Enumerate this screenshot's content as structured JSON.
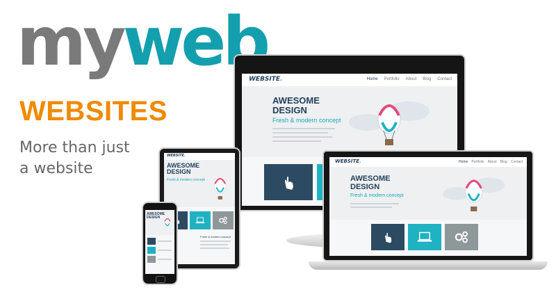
{
  "brand": {
    "logo_part1": "my",
    "logo_part2": "web",
    "headline": "WEBSITES",
    "tagline_line1": "More than just",
    "tagline_line2": "a website"
  },
  "mock_site": {
    "logo": "WEBSITE",
    "logo_dot": ".",
    "nav": [
      "Home",
      "Portfolio",
      "About",
      "Blog",
      "Contact"
    ],
    "hero_title_line1": "AWESOME",
    "hero_title_line2": "DESIGN",
    "hero_subtitle": "Fresh & modern concept",
    "tile_icons": [
      "touch-hand-icon",
      "laptop-icon",
      "gears-icon"
    ]
  },
  "colors": {
    "logo_grey": "#7a7a7a",
    "logo_teal": "#149fae",
    "headline_orange": "#f08a00",
    "tile_navy": "#2d4a63",
    "tile_teal": "#1fb2c2",
    "tile_grey": "#8e9799"
  }
}
